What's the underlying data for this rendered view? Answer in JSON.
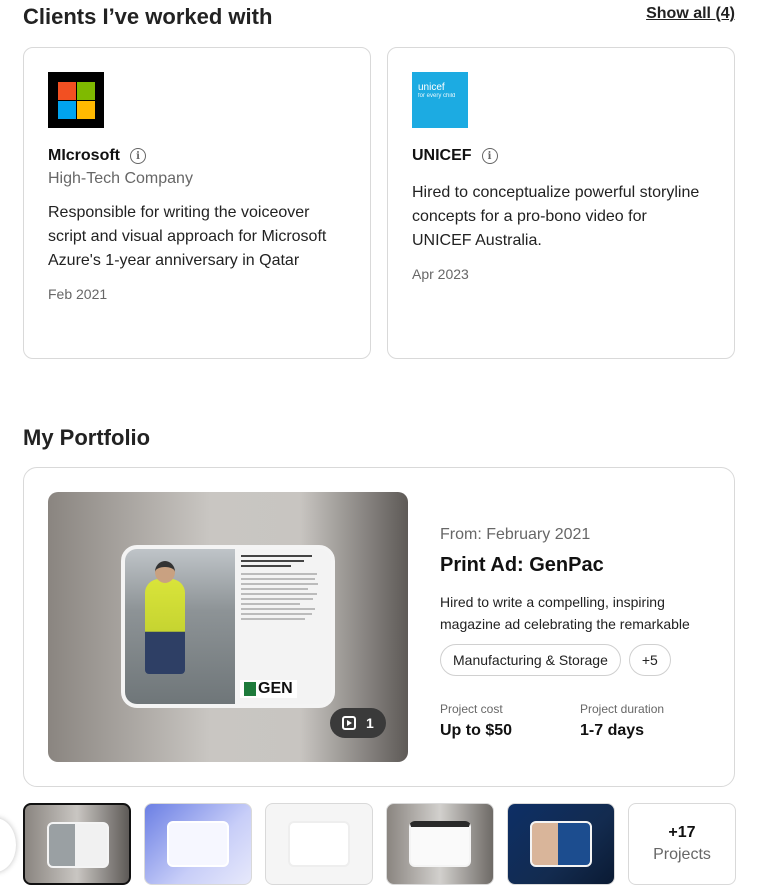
{
  "clients": {
    "title": "Clients I’ve worked with",
    "show_all": "Show all (4)",
    "items": [
      {
        "name": "MIcrosoft",
        "type": "High-Tech Company",
        "description": "Responsible for writing the voiceover script and visual approach for Microsoft Azure's 1-year anniversary in Qatar",
        "date": "Feb 2021",
        "logo_colors": [
          "#f25022",
          "#7fba00",
          "#00a4ef",
          "#ffb900"
        ]
      },
      {
        "name": "UNICEF",
        "logo_text": "unicef",
        "logo_sub": "for every child",
        "description": "Hired to conceptualize powerful storyline concepts for a pro-bono video for UNICEF Australia.",
        "date": "Apr 2023",
        "logo_color": "#1cabe2"
      }
    ]
  },
  "portfolio": {
    "title": "My Portfolio",
    "featured": {
      "date": "From: February 2021",
      "title": "Print Ad: GenPac",
      "description": "Hired to write a compelling, inspiring magazine ad celebrating the remarkable",
      "tags": [
        "Manufacturing & Storage",
        "+5"
      ],
      "media_count": "1",
      "image_logo_text": "GEN",
      "cost_label": "Project cost",
      "cost_value": "Up to $50",
      "duration_label": "Project duration",
      "duration_value": "1-7 days"
    },
    "more": {
      "count": "+17",
      "label": "Projects"
    }
  }
}
